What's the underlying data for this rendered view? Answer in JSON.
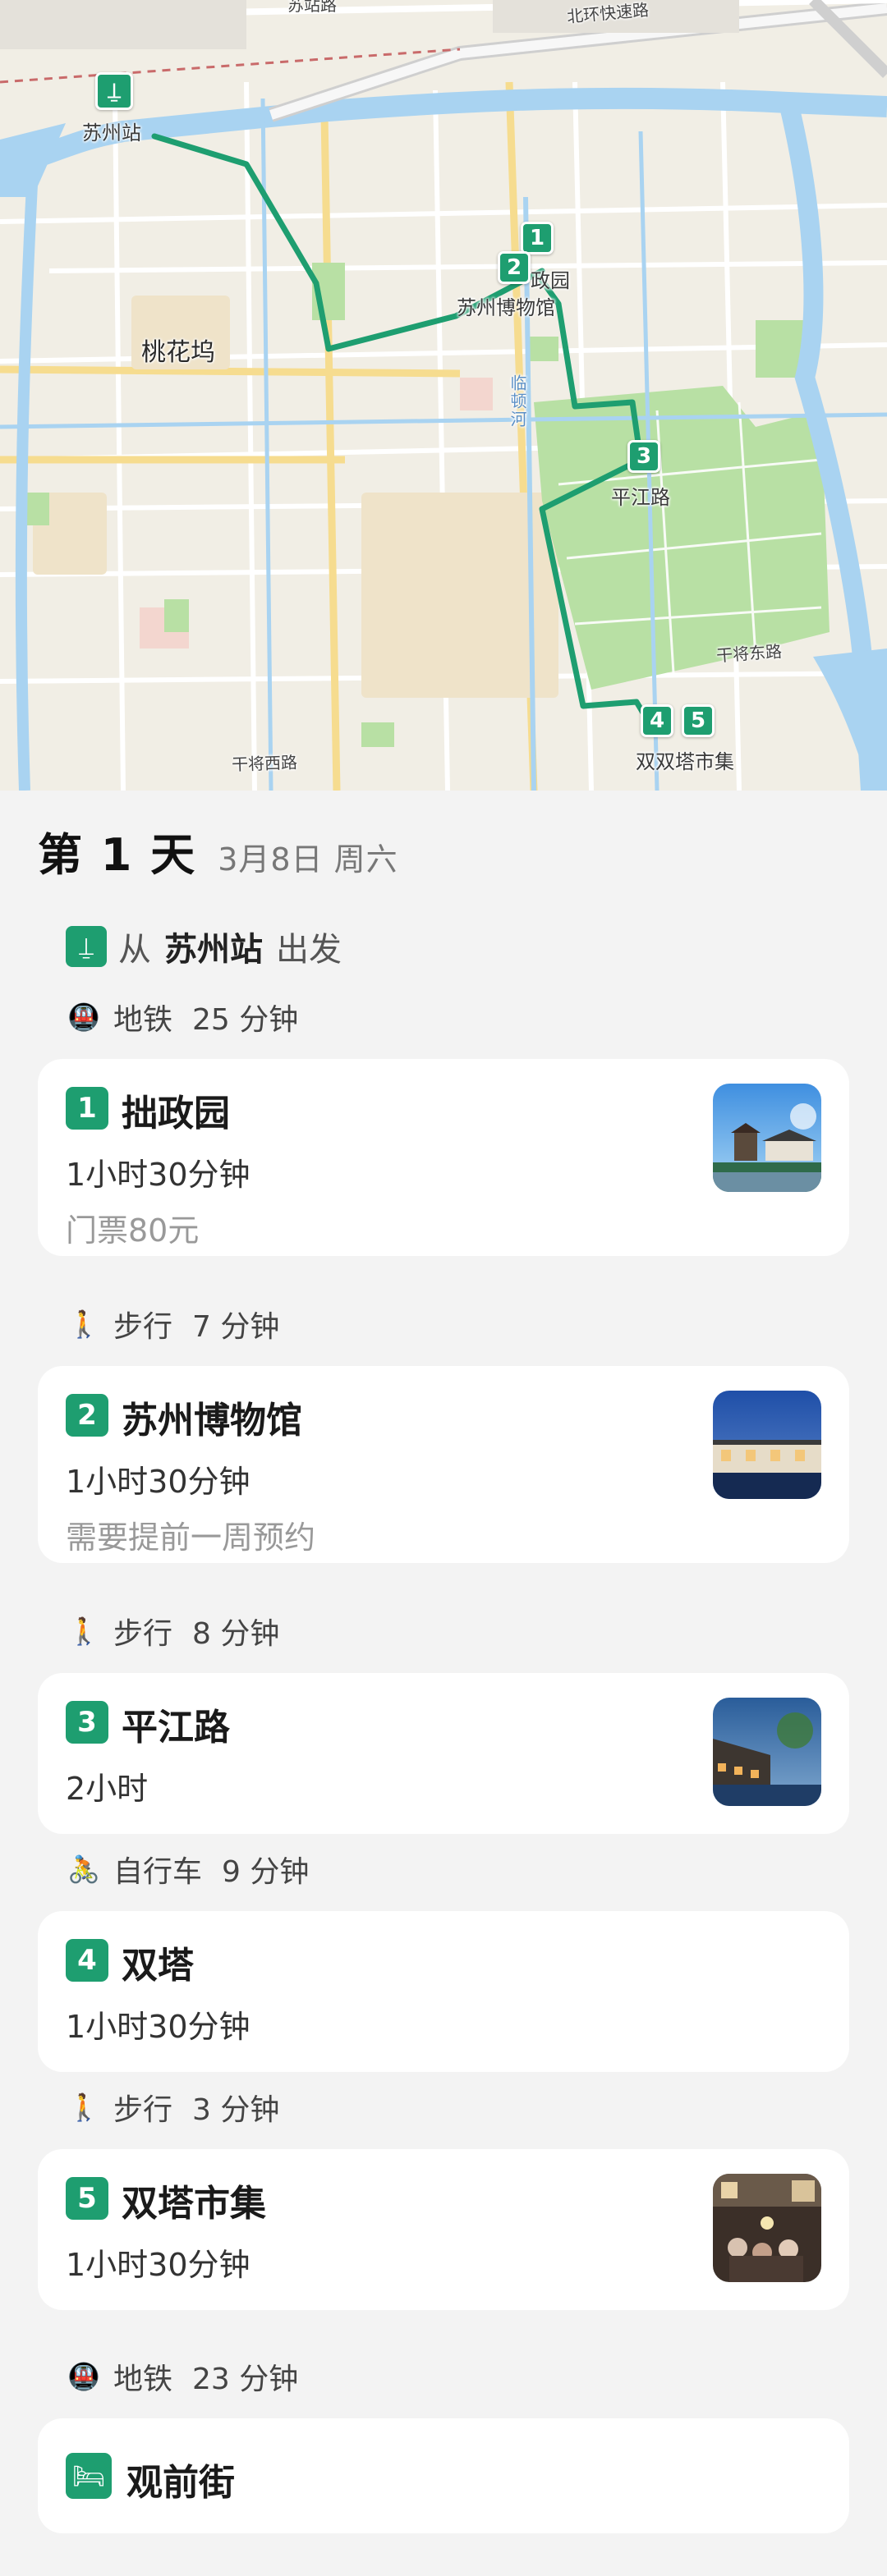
{
  "map": {
    "labels": {
      "station": "苏州站",
      "taohuawu": "桃花坞",
      "museum": "苏州博物馆",
      "zhuozheng_partial": "政园",
      "pingjiang": "平江路",
      "shuangta_market": "双双塔市集",
      "river": "临顿河",
      "ring_road": "北环快速路",
      "top_partial": "苏站路",
      "ganjiang_west": "干将西路",
      "ganjiang_east": "干将东路"
    },
    "pins": [
      "1",
      "2",
      "3",
      "4",
      "5"
    ],
    "colors": {
      "route": "#1e9e70",
      "water": "#a9d3f1",
      "park": "#b5e0a3"
    }
  },
  "day": {
    "title": "第 1 天",
    "date": "3月8日 周六"
  },
  "start": {
    "icon": "train-station-icon",
    "prefix": "从",
    "place": "苏州站",
    "suffix": "出发"
  },
  "transits": [
    {
      "icon": "subway-icon",
      "mode": "地铁",
      "duration": "25 分钟"
    },
    {
      "icon": "walk-icon",
      "mode": "步行",
      "duration": "7 分钟"
    },
    {
      "icon": "walk-icon",
      "mode": "步行",
      "duration": "8 分钟"
    },
    {
      "icon": "bicycle-icon",
      "mode": "自行车",
      "duration": "9 分钟"
    },
    {
      "icon": "walk-icon",
      "mode": "步行",
      "duration": "3 分钟"
    },
    {
      "icon": "subway-icon",
      "mode": "地铁",
      "duration": "23 分钟"
    }
  ],
  "stops": [
    {
      "num": "1",
      "name": "拙政园",
      "duration": "1小时30分钟",
      "note": "门票80元"
    },
    {
      "num": "2",
      "name": "苏州博物馆",
      "duration": "1小时30分钟",
      "note": "需要提前一周预约"
    },
    {
      "num": "3",
      "name": "平江路",
      "duration": "2小时"
    },
    {
      "num": "4",
      "name": "双塔",
      "duration": "1小时30分钟"
    },
    {
      "num": "5",
      "name": "双塔市集",
      "duration": "1小时30分钟"
    }
  ],
  "hotel": {
    "icon": "hotel-bed-icon",
    "name": "观前街"
  }
}
